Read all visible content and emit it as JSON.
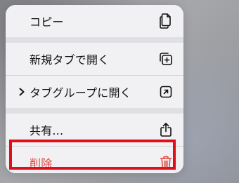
{
  "menu": {
    "items": [
      {
        "label": "コピー",
        "icon": "copy-icon"
      },
      {
        "label": "新規タブで開く",
        "icon": "new-tab-plus-icon"
      },
      {
        "label": "タブグループに開く",
        "icon": "open-arrow-square-icon",
        "has_submenu": true
      },
      {
        "label": "共有...",
        "icon": "share-icon"
      },
      {
        "label": "削除",
        "icon": "trash-icon",
        "destructive": true
      }
    ]
  },
  "colors": {
    "menu_background": "#f1f1f3",
    "separator": "#dfdfe4",
    "destructive": "#e0473f",
    "highlight_box": "#e00f1b"
  }
}
